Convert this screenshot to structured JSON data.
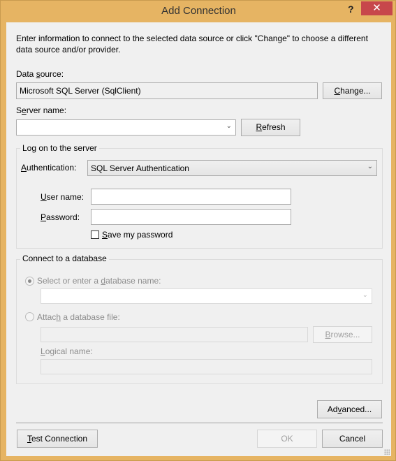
{
  "window": {
    "title": "Add Connection",
    "help_label": "?",
    "close_label": "✕"
  },
  "intro": "Enter information to connect to the selected data source or click \"Change\" to choose a different data source and/or provider.",
  "data_source": {
    "label": "Data source:",
    "value": "Microsoft SQL Server (SqlClient)",
    "change_button": "Change..."
  },
  "server": {
    "label": "Server name:",
    "value": "",
    "refresh_button": "Refresh"
  },
  "logon": {
    "group_title": "Log on to the server",
    "auth_label": "Authentication:",
    "auth_value": "SQL Server Authentication",
    "username_label": "User name:",
    "username_value": "",
    "password_label": "Password:",
    "password_value": "",
    "save_password_label": "Save my password",
    "save_password_checked": false
  },
  "database": {
    "group_title": "Connect to a database",
    "select_option_label": "Select or enter a database name:",
    "select_option_selected": true,
    "database_name_value": "",
    "attach_option_label": "Attach a database file:",
    "attach_option_selected": false,
    "file_value": "",
    "browse_button": "Browse...",
    "logical_name_label": "Logical name:",
    "logical_name_value": ""
  },
  "footer": {
    "advanced_button": "Advanced...",
    "test_button": "Test Connection",
    "ok_button": "OK",
    "cancel_button": "Cancel"
  },
  "colors": {
    "frame": "#e6b463",
    "close_bg": "#c7474b",
    "client_bg": "#f0f0f0"
  }
}
